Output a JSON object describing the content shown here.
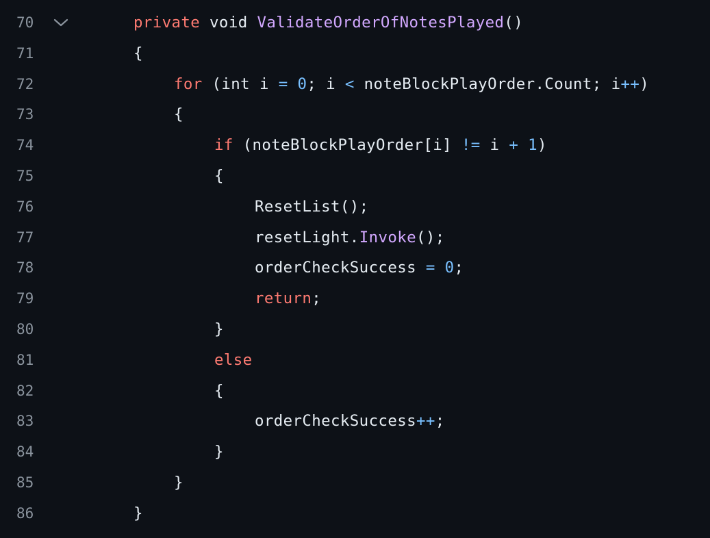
{
  "colors": {
    "background": "#0d1117",
    "line_number": "#8b949e",
    "plain": "#e6edf3",
    "keyword": "#ff7b72",
    "function": "#d2a8ff",
    "operator_number": "#79c0ff",
    "fold_icon": "#8b949e"
  },
  "fold_icon": "chevron-down-icon",
  "lines": [
    {
      "number": "70",
      "indent": 0,
      "tokens": [
        {
          "t": "private",
          "k": "keyword"
        },
        {
          "t": " void ",
          "k": "plain"
        },
        {
          "t": "ValidateOrderOfNotesPlayed",
          "k": "function"
        },
        {
          "t": "()",
          "k": "plain"
        }
      ]
    },
    {
      "number": "71",
      "indent": 0,
      "tokens": [
        {
          "t": "{",
          "k": "plain"
        }
      ]
    },
    {
      "number": "72",
      "indent": 1,
      "tokens": [
        {
          "t": "for",
          "k": "keyword"
        },
        {
          "t": " (int i ",
          "k": "plain"
        },
        {
          "t": "=",
          "k": "operator"
        },
        {
          "t": " ",
          "k": "plain"
        },
        {
          "t": "0",
          "k": "number"
        },
        {
          "t": "; i ",
          "k": "plain"
        },
        {
          "t": "<",
          "k": "operator"
        },
        {
          "t": " noteBlockPlayOrder.Count; i",
          "k": "plain"
        },
        {
          "t": "++",
          "k": "operator"
        },
        {
          "t": ")",
          "k": "plain"
        }
      ]
    },
    {
      "number": "73",
      "indent": 1,
      "tokens": [
        {
          "t": "{",
          "k": "plain"
        }
      ]
    },
    {
      "number": "74",
      "indent": 2,
      "tokens": [
        {
          "t": "if",
          "k": "keyword"
        },
        {
          "t": " (noteBlockPlayOrder[i] ",
          "k": "plain"
        },
        {
          "t": "!=",
          "k": "operator"
        },
        {
          "t": " i ",
          "k": "plain"
        },
        {
          "t": "+",
          "k": "operator"
        },
        {
          "t": " ",
          "k": "plain"
        },
        {
          "t": "1",
          "k": "number"
        },
        {
          "t": ")",
          "k": "plain"
        }
      ]
    },
    {
      "number": "75",
      "indent": 2,
      "tokens": [
        {
          "t": "{",
          "k": "plain"
        }
      ]
    },
    {
      "number": "76",
      "indent": 3,
      "tokens": [
        {
          "t": "ResetList();",
          "k": "plain"
        }
      ]
    },
    {
      "number": "77",
      "indent": 3,
      "tokens": [
        {
          "t": "resetLight.",
          "k": "plain"
        },
        {
          "t": "Invoke",
          "k": "function"
        },
        {
          "t": "();",
          "k": "plain"
        }
      ]
    },
    {
      "number": "78",
      "indent": 3,
      "tokens": [
        {
          "t": "orderCheckSuccess ",
          "k": "plain"
        },
        {
          "t": "=",
          "k": "operator"
        },
        {
          "t": " ",
          "k": "plain"
        },
        {
          "t": "0",
          "k": "number"
        },
        {
          "t": ";",
          "k": "plain"
        }
      ]
    },
    {
      "number": "79",
      "indent": 3,
      "tokens": [
        {
          "t": "return",
          "k": "keyword"
        },
        {
          "t": ";",
          "k": "plain"
        }
      ]
    },
    {
      "number": "80",
      "indent": 2,
      "tokens": [
        {
          "t": "}",
          "k": "plain"
        }
      ]
    },
    {
      "number": "81",
      "indent": 2,
      "tokens": [
        {
          "t": "else",
          "k": "keyword"
        }
      ]
    },
    {
      "number": "82",
      "indent": 2,
      "tokens": [
        {
          "t": "{",
          "k": "plain"
        }
      ]
    },
    {
      "number": "83",
      "indent": 3,
      "tokens": [
        {
          "t": "orderCheckSuccess",
          "k": "plain"
        },
        {
          "t": "++",
          "k": "operator"
        },
        {
          "t": ";",
          "k": "plain"
        }
      ]
    },
    {
      "number": "84",
      "indent": 2,
      "tokens": [
        {
          "t": "}",
          "k": "plain"
        }
      ]
    },
    {
      "number": "85",
      "indent": 1,
      "tokens": [
        {
          "t": "}",
          "k": "plain"
        }
      ]
    },
    {
      "number": "86",
      "indent": 0,
      "tokens": [
        {
          "t": "}",
          "k": "plain"
        }
      ]
    }
  ]
}
